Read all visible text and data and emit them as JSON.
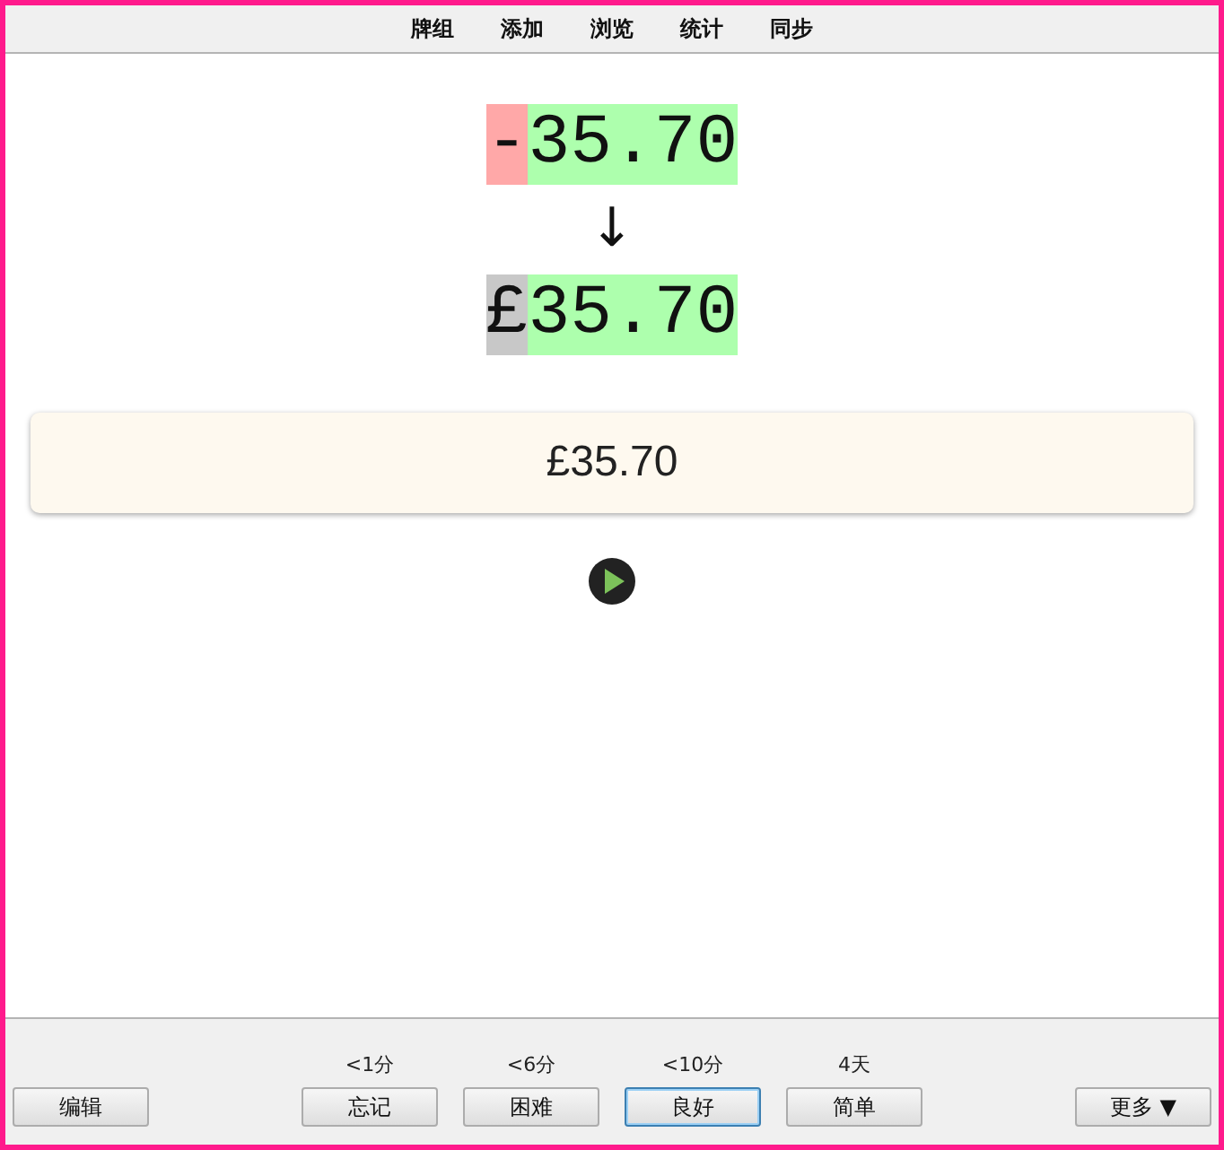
{
  "menu": [
    {
      "label": "牌组"
    },
    {
      "label": "添加"
    },
    {
      "label": "浏览"
    },
    {
      "label": "统计"
    },
    {
      "label": "同步"
    }
  ],
  "comparison": {
    "typed": [
      {
        "text": "-",
        "kind": "bad"
      },
      {
        "text": "35.70",
        "kind": "good"
      }
    ],
    "arrow": "↓",
    "expected": [
      {
        "text": "£",
        "kind": "missing"
      },
      {
        "text": "35.70",
        "kind": "good"
      }
    ]
  },
  "answer": "£35.70",
  "bottom": {
    "edit": "编辑",
    "more": "更多 ▼",
    "answers": [
      {
        "interval": "<1分",
        "label": "忘记",
        "selected": false
      },
      {
        "interval": "<6分",
        "label": "困难",
        "selected": false
      },
      {
        "interval": "<10分",
        "label": "良好",
        "selected": true
      },
      {
        "interval": "4天",
        "label": "简单",
        "selected": false
      }
    ]
  }
}
